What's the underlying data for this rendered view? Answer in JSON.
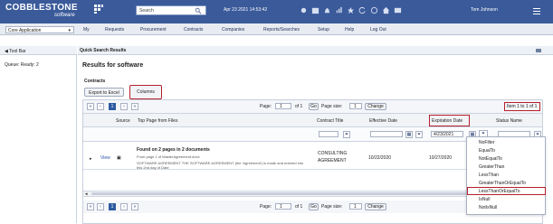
{
  "header": {
    "brand_title": "COBBLESTONE",
    "brand_subtitle": "software",
    "search_placeholder": "Search",
    "datetime": "Apr 23 2021 14:53:42",
    "user_name": "Tom Johnson"
  },
  "menubar": {
    "application_select": "Core Application",
    "items": [
      "My",
      "Requests",
      "Procurement",
      "Contracts",
      "Companies",
      "Reports/Searches",
      "Setup",
      "Help",
      "Log Out"
    ]
  },
  "left_panel": {
    "tool_bar_label": "Tool Bar",
    "queue_label": "Queue: Ready: 2"
  },
  "main": {
    "panel_title": "Quick Search Results",
    "results_title": "Results for software",
    "section_title": "Contracts",
    "export_button": "Export to Excel",
    "columns_button": "Columns"
  },
  "grid": {
    "pager_top": {
      "page_label": "Page:",
      "page_value": "1",
      "of_label": "of 1",
      "go_label": "Go",
      "page_size_label": "Page size:",
      "page_size_value": "1",
      "change_label": "Change",
      "item_count": "Item 1 to 1 of 1"
    },
    "columns": [
      "Source",
      "Top Page from Files",
      "Contract Title",
      "Effective Date",
      "Expiration Date",
      "Status Name"
    ],
    "filter_values": {
      "expiration_date": "4/23/2021"
    },
    "row": {
      "view_link": "View",
      "found_text": "Found on 2 pages in 2 documents",
      "source_text": "From page 1 of MasterAgreement.docx",
      "snippet": "SOFTWARE AGREEMENT THE SOFTWARE AGREEMENT (the 'Agreement') is made and entered into this 2nd day of Date",
      "contract_title": "CONSULTING AGREEMENT",
      "effective_date": "10/22/2020",
      "expiration_date": "10/27/2020"
    },
    "filter_menu": [
      "NoFilter",
      "EqualTo",
      "NotEqualTo",
      "GreaterThan",
      "LessThan",
      "GreaterThanOrEqualTo",
      "LessThanOrEqualTo",
      "IsNull",
      "NotIsNull"
    ]
  },
  "colors": {
    "header_blue": "#3a5a9a",
    "accent_red": "#b41f2b"
  }
}
